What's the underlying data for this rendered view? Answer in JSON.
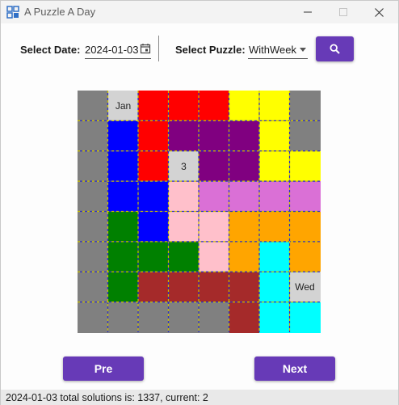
{
  "window": {
    "title": "A Puzzle A Day",
    "icons": {
      "app": "puzzle-app-icon",
      "minimize": "minimize-icon",
      "maximize": "maximize-icon",
      "close": "close-icon"
    }
  },
  "toolbar": {
    "date_label": "Select Date:",
    "date_value": "2024-01-03",
    "date_icon": "calendar-icon",
    "puzzle_label": "Select Puzzle:",
    "puzzle_value": "WithWeek",
    "search_icon": "search-icon",
    "accent_color": "#673ab7"
  },
  "board": {
    "colors": {
      "G": "#808080",
      "L": "#d3d3d3",
      "R": "#ff0000",
      "Y": "#ffff00",
      "B": "#0000ff",
      "P": "#800080",
      "K": "#ffc0cb",
      "O": "#da70d6",
      "N": "#008000",
      "A": "#ffa500",
      "C": "#00ffff",
      "M": "#a52a2a"
    },
    "rows": [
      [
        "G",
        "L",
        "R",
        "R",
        "R",
        "Y",
        "Y",
        "G"
      ],
      [
        "G",
        "B",
        "R",
        "P",
        "P",
        "P",
        "Y",
        "G"
      ],
      [
        "G",
        "B",
        "R",
        "L",
        "P",
        "P",
        "Y",
        "Y"
      ],
      [
        "G",
        "B",
        "B",
        "K",
        "O",
        "O",
        "O",
        "O"
      ],
      [
        "G",
        "N",
        "B",
        "K",
        "K",
        "A",
        "A",
        "A"
      ],
      [
        "G",
        "N",
        "N",
        "N",
        "K",
        "A",
        "C",
        "A"
      ],
      [
        "G",
        "N",
        "M",
        "M",
        "M",
        "M",
        "C",
        "L"
      ],
      [
        "G",
        "G",
        "G",
        "G",
        "G",
        "M",
        "C",
        "C"
      ]
    ],
    "labels": [
      {
        "row": 0,
        "col": 1,
        "text": "Jan"
      },
      {
        "row": 2,
        "col": 3,
        "text": "3"
      },
      {
        "row": 6,
        "col": 7,
        "text": "Wed"
      }
    ]
  },
  "buttons": {
    "pre_label": "Pre",
    "next_label": "Next"
  },
  "status": {
    "text": "2024-01-03 total solutions is: 1337, current: 2"
  }
}
